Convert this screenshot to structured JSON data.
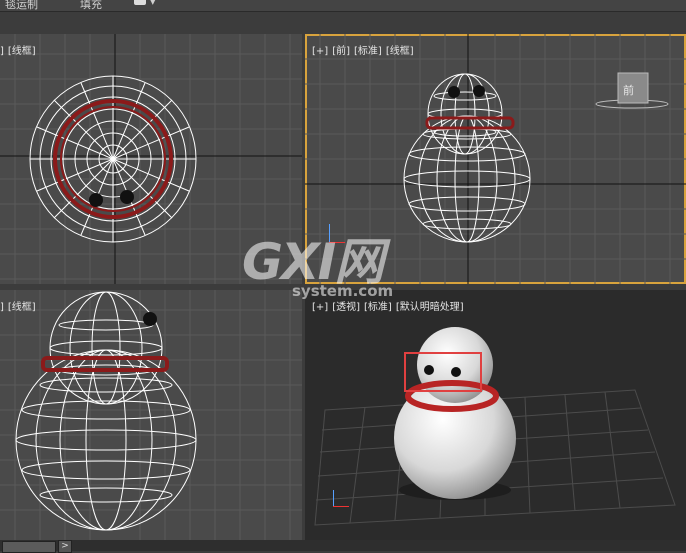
{
  "toolbar": {
    "item_1": "毯运制",
    "item_2": "填充"
  },
  "viewports": {
    "top": {
      "labels": [
        "]",
        "[线框]"
      ]
    },
    "front": {
      "labels": [
        "[+]",
        "[前]",
        "[标准]",
        "[线框]"
      ]
    },
    "left": {
      "labels": [
        "]",
        "[线框]"
      ]
    },
    "perspective": {
      "labels": [
        "[+]",
        "[透视]",
        "[标准]",
        "[默认明暗处理]"
      ]
    }
  },
  "viewcube_label": "前",
  "watermark": {
    "main": "GXI网",
    "sub": "system.com"
  },
  "statusbar": {
    "arrow": ">"
  },
  "colors": {
    "viewport_bg": "#4a4a4a",
    "wireframe": "#ffffff",
    "scarf": "#8b1a1a",
    "active_border": "#d8a33d",
    "highlight_box": "#e04040"
  }
}
